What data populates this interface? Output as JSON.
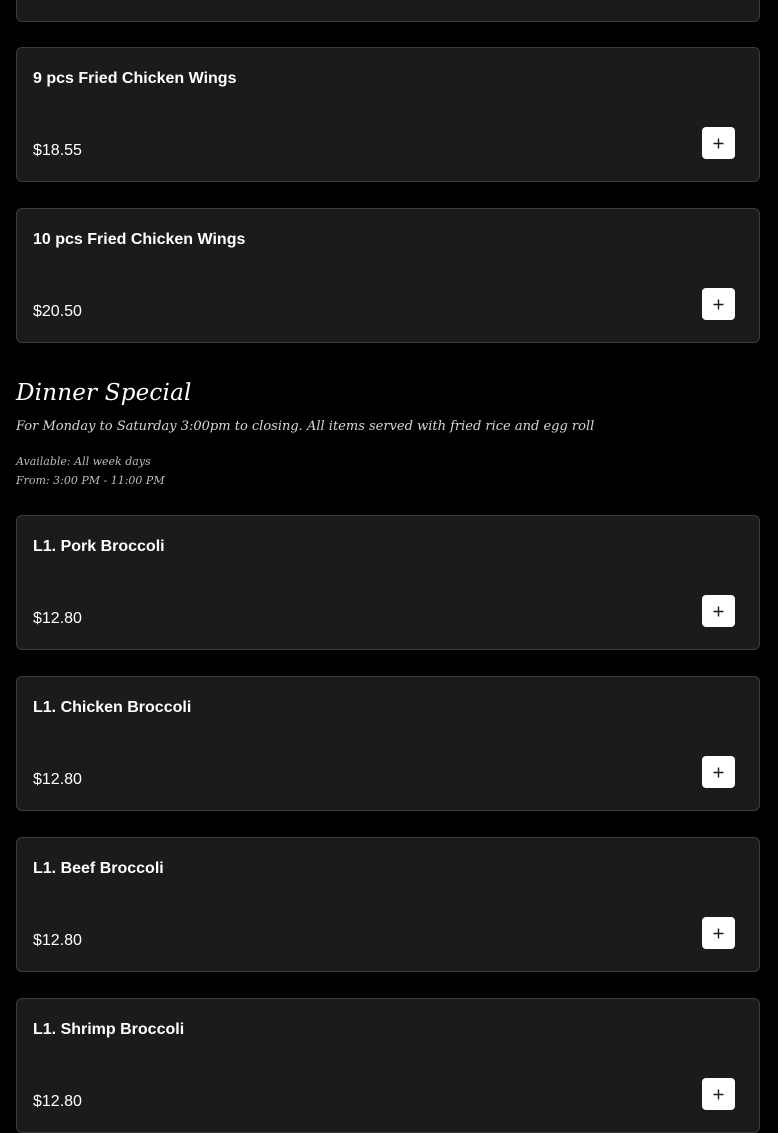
{
  "previous_items": [
    {
      "name": "9 pcs Fried Chicken Wings",
      "price": "$18.55",
      "add_icon": "plus-icon"
    },
    {
      "name": "10 pcs Fried Chicken Wings",
      "price": "$20.50",
      "add_icon": "plus-icon"
    }
  ],
  "dinner_special": {
    "title": "Dinner Special",
    "description": "For Monday to Saturday 3:00pm to closing. All items served with fried rice and egg roll",
    "available": "Available: All week days",
    "hours": "From: 3:00 PM - 11:00 PM",
    "items": [
      {
        "name": "L1. Pork Broccoli",
        "price": "$12.80",
        "add_icon": "plus-icon"
      },
      {
        "name": "L1. Chicken Broccoli",
        "price": "$12.80",
        "add_icon": "plus-icon"
      },
      {
        "name": "L1. Beef Broccoli",
        "price": "$12.80",
        "add_icon": "plus-icon"
      },
      {
        "name": "L1. Shrimp Broccoli",
        "price": "$12.80",
        "add_icon": "plus-icon"
      }
    ]
  },
  "colors": {
    "background": "#000000",
    "card": "#1b1b1b",
    "card_border": "#3c3c3c",
    "add_button": "#ffffff"
  }
}
